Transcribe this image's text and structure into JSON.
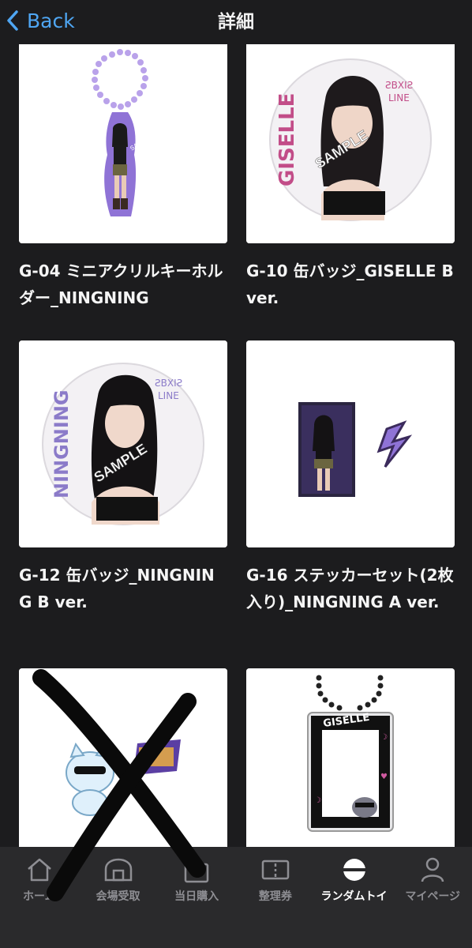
{
  "header": {
    "back_label": "Back",
    "title": "詳細"
  },
  "items": [
    {
      "caption": "G-04 ミニアクリルキーホルダー_NINGNING"
    },
    {
      "caption": "G-10 缶バッジ_GISELLE B ver.",
      "badge_name": "GISELLE",
      "sample": "SAMPLE"
    },
    {
      "caption": "G-12 缶バッジ_NINGNING B ver.",
      "badge_name": "NINGNING",
      "sample": "SAMPLE"
    },
    {
      "caption": "G-16 ステッカーセット(2枚入り)_NINGNING A ver."
    },
    {
      "caption": ""
    },
    {
      "caption": ""
    }
  ],
  "tabbar": {
    "items": [
      {
        "label": "ホーム",
        "icon": "home-icon"
      },
      {
        "label": "会場受取",
        "icon": "pickup-icon"
      },
      {
        "label": "当日購入",
        "icon": "bag-icon"
      },
      {
        "label": "整理券",
        "icon": "ticket-icon"
      },
      {
        "label": "ランダムトイ",
        "icon": "capsule-icon",
        "active": true
      },
      {
        "label": "マイページ",
        "icon": "person-icon"
      }
    ]
  },
  "colors": {
    "accent": "#4fa6f3",
    "background": "#1c1c1e",
    "tabbar": "#2a2a2c",
    "purple": "#9b7fe0"
  }
}
